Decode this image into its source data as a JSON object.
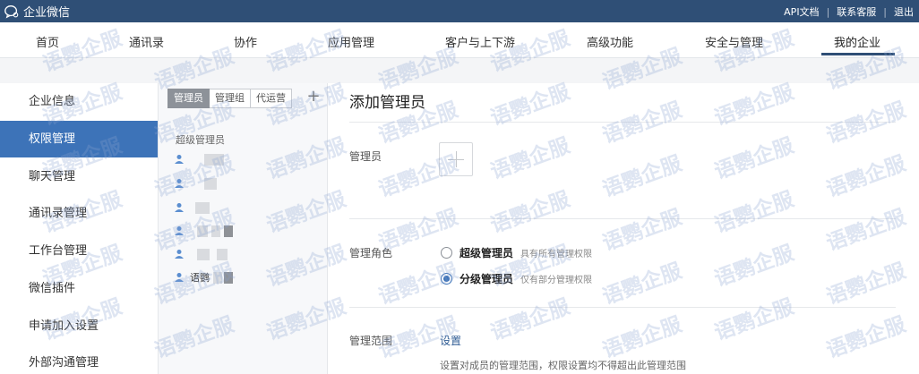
{
  "app": {
    "title": "企业微信"
  },
  "top_links": [
    {
      "label": "API文档"
    },
    {
      "label": "联系客服"
    },
    {
      "label": "退出"
    }
  ],
  "nav": {
    "items": [
      {
        "label": "首页"
      },
      {
        "label": "通讯录"
      },
      {
        "label": "协作"
      },
      {
        "label": "应用管理"
      },
      {
        "label": "客户与上下游"
      },
      {
        "label": "高级功能"
      },
      {
        "label": "安全与管理"
      },
      {
        "label": "我的企业"
      }
    ],
    "active_index": 7
  },
  "sidebar": {
    "items": [
      {
        "label": "企业信息"
      },
      {
        "label": "权限管理"
      },
      {
        "label": "聊天管理"
      },
      {
        "label": "通讯录管理"
      },
      {
        "label": "工作台管理"
      },
      {
        "label": "微信插件"
      },
      {
        "label": "申请加入设置"
      },
      {
        "label": "外部沟通管理"
      }
    ],
    "active_index": 1
  },
  "admin_panel": {
    "tabs": [
      {
        "label": "管理员"
      },
      {
        "label": "管理组"
      },
      {
        "label": "代运营"
      }
    ],
    "active_tab": 0,
    "add_symbol": "+",
    "group_label": "超级管理员",
    "visible_name": "语鹦"
  },
  "form": {
    "title": "添加管理员",
    "admin_label": "管理员",
    "role_label": "管理角色",
    "roles": [
      {
        "label": "超级管理员",
        "hint": "具有所有管理权限",
        "checked": false
      },
      {
        "label": "分级管理员",
        "hint": "仅有部分管理权限",
        "checked": true
      }
    ],
    "scope_label": "管理范围",
    "scope_link": "设置",
    "scope_desc": "设置对成员的管理范围，权限设置均不得超出此管理范围"
  },
  "watermark": {
    "text": "语鹦企服"
  },
  "colors": {
    "topbar": "#2f4f76",
    "sidebar_active": "#3d73b8",
    "link": "#2f5c94"
  }
}
